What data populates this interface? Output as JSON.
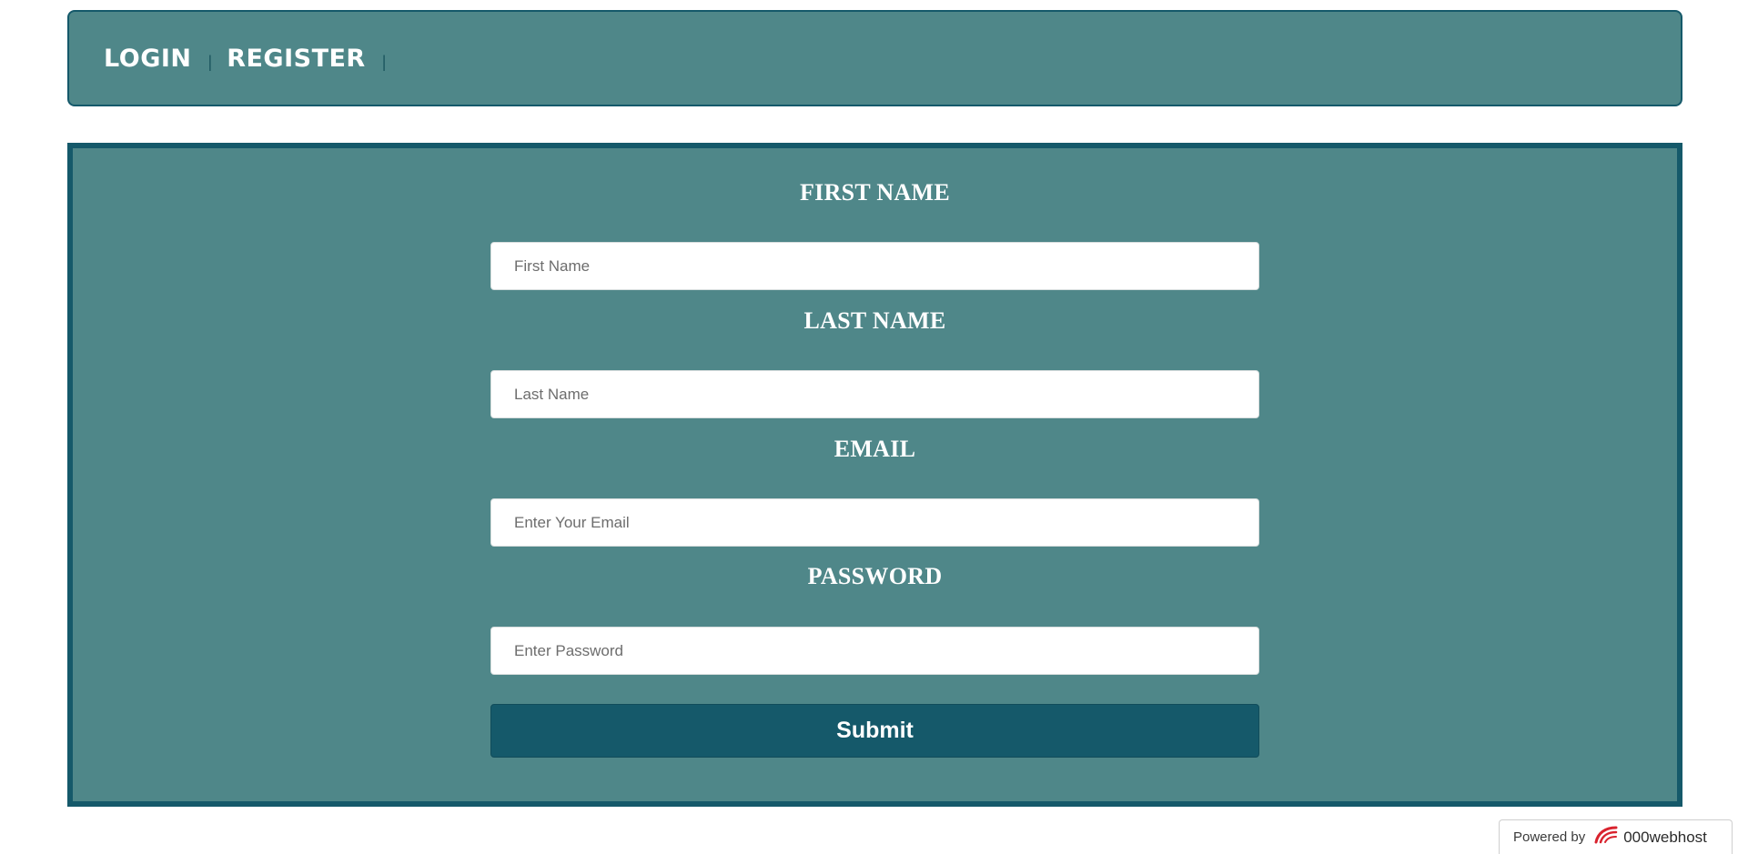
{
  "nav": {
    "items": [
      {
        "label": "LOGIN"
      },
      {
        "label": "REGISTER"
      }
    ],
    "separator": "|"
  },
  "form": {
    "fields": [
      {
        "label": "FIRST NAME",
        "placeholder": "First Name",
        "value": ""
      },
      {
        "label": "LAST NAME",
        "placeholder": "Last Name",
        "value": ""
      },
      {
        "label": "EMAIL",
        "placeholder": "Enter Your Email",
        "value": ""
      },
      {
        "label": "PASSWORD",
        "placeholder": "Enter Password",
        "value": ""
      }
    ],
    "submit_label": "Submit"
  },
  "badge": {
    "prefix": "Powered by",
    "brand": "000webhost",
    "icon": "000webhost-logo-icon"
  },
  "colors": {
    "panel": "#4f8789",
    "border": "#15596a",
    "button": "#15596a",
    "text": "#ffffff"
  }
}
